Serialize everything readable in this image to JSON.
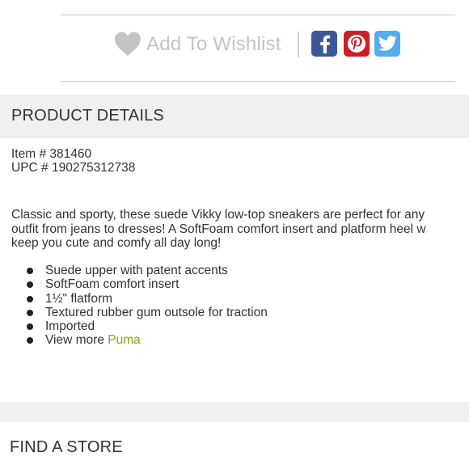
{
  "wishlist": {
    "label": "Add To Wishlist",
    "icon": "heart-icon",
    "color": "#c4c4c4"
  },
  "social": [
    {
      "network": "facebook",
      "icon": "facebook-icon",
      "color": "#3b5998"
    },
    {
      "network": "pinterest",
      "icon": "pinterest-icon",
      "color": "#cb2027"
    },
    {
      "network": "twitter",
      "icon": "twitter-icon",
      "color": "#55acee"
    }
  ],
  "product_details": {
    "title": "PRODUCT DETAILS",
    "item_line": "Item # 381460",
    "upc_line": "UPC # 190275312738",
    "description_lines": [
      "Classic and sporty, these suede Vikky low-top sneakers are perfect for any",
      "outfit from jeans to dresses! A SoftFoam comfort insert and platform heel w",
      "keep you cute and comfy all day long!"
    ],
    "features": [
      "Suede upper with patent accents",
      "SoftFoam comfort insert",
      "1½\" flatform",
      "Textured rubber gum outsole for traction",
      "Imported"
    ],
    "view_more_prefix": "View more ",
    "brand_link": "Puma",
    "brand_link_color": "#7aa812"
  },
  "find_store": {
    "title": "FIND A STORE"
  }
}
